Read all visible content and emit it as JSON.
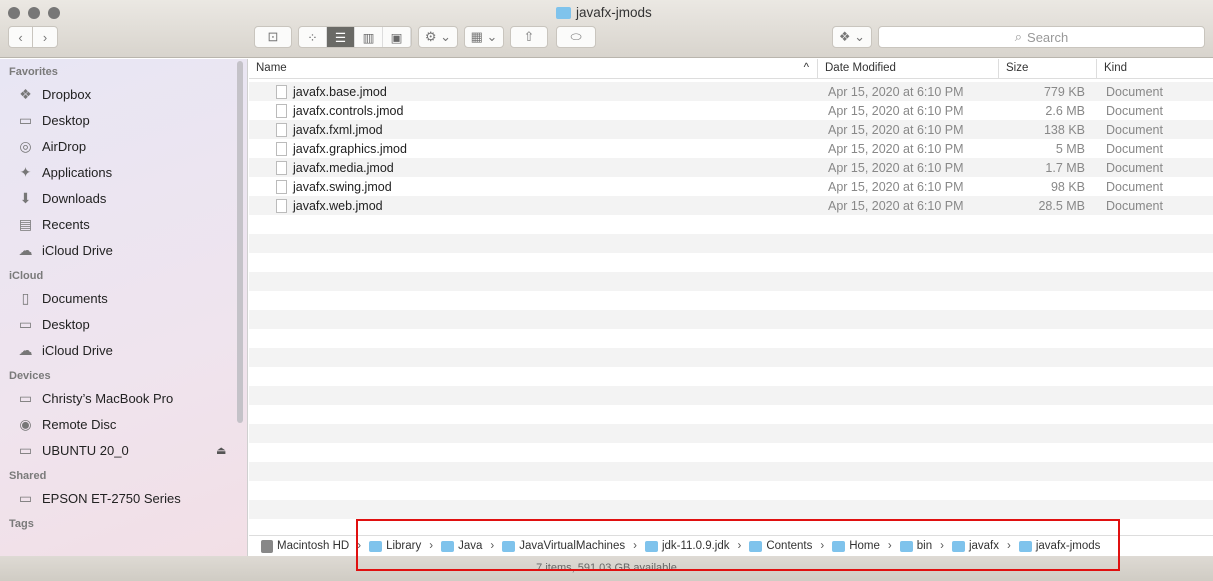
{
  "window": {
    "title": "javafx-jmods"
  },
  "toolbar": {
    "back": "‹",
    "forward": "›",
    "search_placeholder": "Search"
  },
  "sidebar": {
    "sections": [
      {
        "title": "Favorites",
        "items": [
          {
            "label": "Dropbox",
            "icon": "❖"
          },
          {
            "label": "Desktop",
            "icon": "▭"
          },
          {
            "label": "AirDrop",
            "icon": "◎"
          },
          {
            "label": "Applications",
            "icon": "✦"
          },
          {
            "label": "Downloads",
            "icon": "⬇"
          },
          {
            "label": "Recents",
            "icon": "▤"
          },
          {
            "label": "iCloud Drive",
            "icon": "☁"
          }
        ]
      },
      {
        "title": "iCloud",
        "items": [
          {
            "label": "Documents",
            "icon": "▯"
          },
          {
            "label": "Desktop",
            "icon": "▭"
          },
          {
            "label": "iCloud Drive",
            "icon": "☁"
          }
        ]
      },
      {
        "title": "Devices",
        "items": [
          {
            "label": "Christy’s MacBook Pro",
            "icon": "▭"
          },
          {
            "label": "Remote Disc",
            "icon": "◉"
          },
          {
            "label": "UBUNTU 20_0",
            "icon": "▭",
            "eject": "⏏"
          }
        ]
      },
      {
        "title": "Shared",
        "items": [
          {
            "label": "EPSON ET-2750 Series",
            "icon": "▭"
          }
        ]
      },
      {
        "title": "Tags",
        "items": []
      }
    ]
  },
  "columns": {
    "name": "Name",
    "date": "Date Modified",
    "size": "Size",
    "kind": "Kind"
  },
  "files": [
    {
      "name": "javafx.base.jmod",
      "date": "Apr 15, 2020 at 6:10 PM",
      "size": "779 KB",
      "kind": "Document"
    },
    {
      "name": "javafx.controls.jmod",
      "date": "Apr 15, 2020 at 6:10 PM",
      "size": "2.6 MB",
      "kind": "Document"
    },
    {
      "name": "javafx.fxml.jmod",
      "date": "Apr 15, 2020 at 6:10 PM",
      "size": "138 KB",
      "kind": "Document"
    },
    {
      "name": "javafx.graphics.jmod",
      "date": "Apr 15, 2020 at 6:10 PM",
      "size": "5 MB",
      "kind": "Document"
    },
    {
      "name": "javafx.media.jmod",
      "date": "Apr 15, 2020 at 6:10 PM",
      "size": "1.7 MB",
      "kind": "Document"
    },
    {
      "name": "javafx.swing.jmod",
      "date": "Apr 15, 2020 at 6:10 PM",
      "size": "98 KB",
      "kind": "Document"
    },
    {
      "name": "javafx.web.jmod",
      "date": "Apr 15, 2020 at 6:10 PM",
      "size": "28.5 MB",
      "kind": "Document"
    }
  ],
  "path": [
    "Macintosh HD",
    "Library",
    "Java",
    "JavaVirtualMachines",
    "jdk-11.0.9.jdk",
    "Contents",
    "Home",
    "bin",
    "javafx",
    "javafx-jmods"
  ],
  "status": "7 items, 591.03 GB available"
}
